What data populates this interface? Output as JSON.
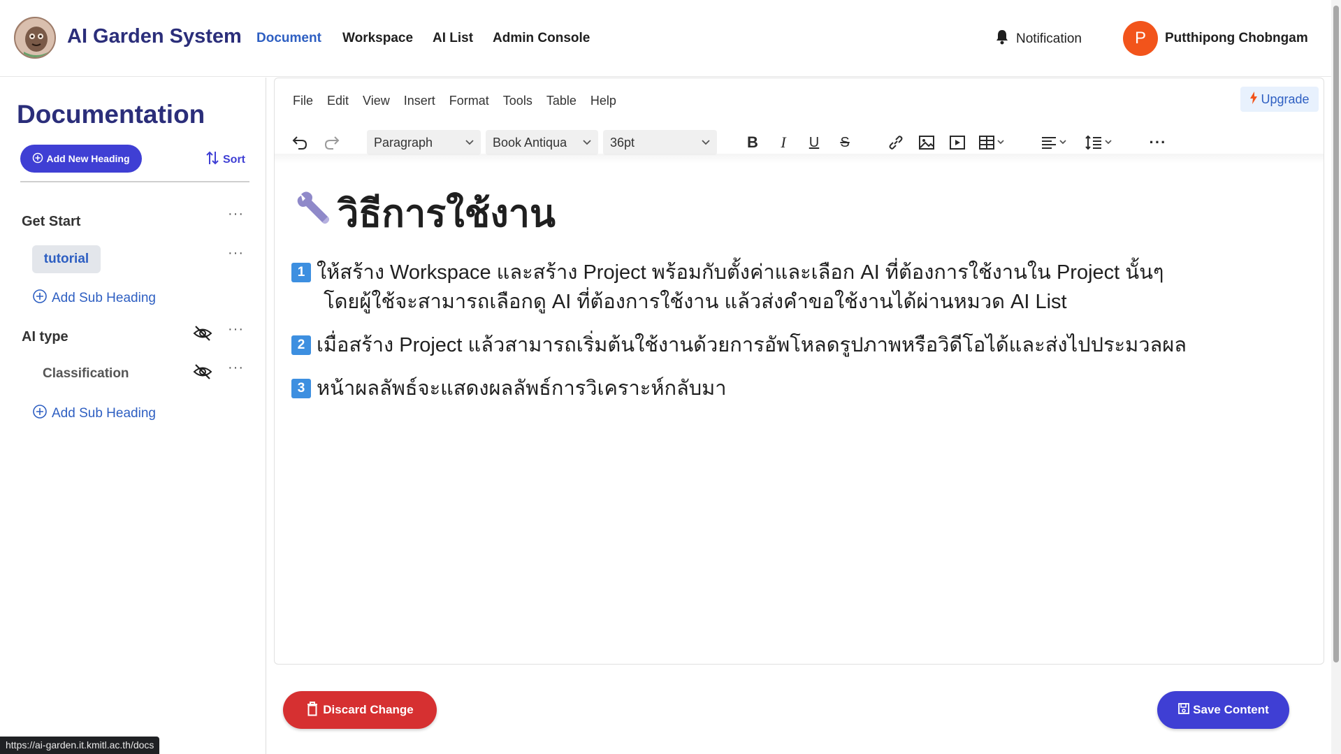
{
  "topbar": {
    "brand": "AI Garden System",
    "nav": [
      "Document",
      "Workspace",
      "AI List",
      "Admin Console"
    ],
    "active_nav": "Document",
    "notification_label": "Notification",
    "avatar_initial": "P",
    "username": "Putthipong Chobngam"
  },
  "sidebar": {
    "title": "Documentation",
    "add_heading_label": "Add New Heading",
    "sort_label": "Sort",
    "headings": [
      {
        "label": "Get Start",
        "subs": [
          {
            "label": "tutorial",
            "selected": true
          }
        ],
        "add_sub_label": "Add Sub Heading"
      },
      {
        "label": "AI type",
        "hidden": true,
        "subs": [
          {
            "label": "Classification",
            "hidden": true
          }
        ],
        "add_sub_label": "Add Sub Heading"
      }
    ],
    "more_icon": "more-horizontal-icon",
    "hidden_icon": "eye-off-icon"
  },
  "editor": {
    "menu": [
      "File",
      "Edit",
      "View",
      "Insert",
      "Format",
      "Tools",
      "Table",
      "Help"
    ],
    "upgrade_label": "Upgrade",
    "block_format": "Paragraph",
    "font_family": "Book Antiqua",
    "font_size": "36pt",
    "toolbar_icons": [
      "undo-icon",
      "redo-icon",
      "bold-icon",
      "italic-icon",
      "underline-icon",
      "strikethrough-icon",
      "link-icon",
      "image-icon",
      "media-icon",
      "table-icon",
      "align-icon",
      "line-height-icon",
      "more-icon"
    ],
    "doc_title": "วิธีการใช้งาน",
    "paragraphs": [
      {
        "num": "1",
        "line1": "ให้สร้าง Workspace และสร้าง Project พร้อมกับตั้งค่าและเลือก AI ที่ต้องการใช้งานใน Project นั้นๆ",
        "line2": "โดยผู้ใช้จะสามารถเลือกดู AI ที่ต้องการใช้งาน แล้วส่งคำขอใช้งานได้ผ่านหมวด AI List"
      },
      {
        "num": "2",
        "line1": "เมื่อสร้าง Project แล้วสามารถเริ่มต้นใช้งานด้วยการอัพโหลดรูปภาพหรือวิดีโอได้และส่งไปประมวลผล"
      },
      {
        "num": "3",
        "line1": "หน้าผลลัพธ์จะแสดงผลลัพธ์การวิเคราะห์กลับมา"
      }
    ]
  },
  "actions": {
    "discard_label": "Discard Change",
    "save_label": "Save Content"
  },
  "status_url": "https://ai-garden.it.kmitl.ac.th/docs",
  "colors": {
    "brand": "#2b2e7a",
    "accent": "#3f3fd4",
    "link": "#2e5fc2",
    "danger": "#d63031",
    "avatar": "#f2541b"
  }
}
